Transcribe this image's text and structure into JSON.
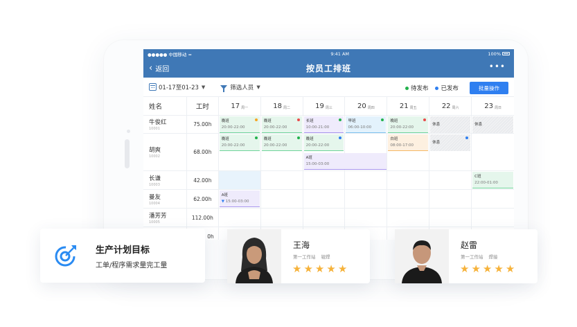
{
  "status_bar": {
    "carrier": "●●●●● 中国移动 ≈",
    "time": "9:41 AM",
    "battery": "100%"
  },
  "nav": {
    "back": "返回",
    "title": "按员工排班",
    "more": "•••"
  },
  "toolbar": {
    "date_range": "01-17至01-23",
    "filter": "筛选人员",
    "legend_pending": "待发布",
    "legend_published": "已发布",
    "batch": "批量操作",
    "colors": {
      "pending": "#22b14c",
      "published": "#2f7ff0",
      "brand": "#3f78b6"
    }
  },
  "grid": {
    "col_name": "姓名",
    "col_hours": "工时",
    "days": [
      {
        "num": "17",
        "wd": "周一"
      },
      {
        "num": "18",
        "wd": "周二"
      },
      {
        "num": "19",
        "wd": "周三"
      },
      {
        "num": "20",
        "wd": "周四"
      },
      {
        "num": "21",
        "wd": "周五"
      },
      {
        "num": "22",
        "wd": "周六"
      },
      {
        "num": "23",
        "wd": "周日"
      }
    ],
    "employees": [
      {
        "name": "牛俊红",
        "id": "10001",
        "hours": "75.00h"
      },
      {
        "name": "胡爽",
        "id": "10002",
        "hours": "68.00h"
      },
      {
        "name": "长谦",
        "id": "10003",
        "hours": "42.00h"
      },
      {
        "name": "曼友",
        "id": "10004",
        "hours": "62.00h"
      },
      {
        "name": "潘芳芳",
        "id": "10005",
        "hours": "112.00h"
      },
      {
        "hours": "0h"
      }
    ],
    "shifts": {
      "e1d1": {
        "name": "晚班",
        "time": "20:00-22:00"
      },
      "e1d2": {
        "name": "晚班",
        "time": "20:00-22:00"
      },
      "e1d3": {
        "name": "长班",
        "time": "10:00-21:00"
      },
      "e1d4": {
        "name": "早班",
        "time": "06:00-10:00"
      },
      "e1d5": {
        "name": "晚班",
        "time": "20:00-22:00"
      },
      "e1d6": {
        "name": "休息"
      },
      "e1d7": {
        "name": "休息"
      },
      "e2d1": {
        "name": "晚班",
        "time": "20:00-22:00"
      },
      "e2d2": {
        "name": "晚班",
        "time": "20:00-22:00"
      },
      "e2d3": {
        "name": "晚班",
        "time": "20:00-22:00"
      },
      "e2d3b": {
        "name": "A班",
        "time": "15:00-03:00"
      },
      "e2d5": {
        "name": "白班",
        "time": "08:00-17:00"
      },
      "e2d6": {
        "name": "休息"
      },
      "e3d7": {
        "name": "C班",
        "time": "22:00-01:00"
      },
      "e4d1": {
        "name": "A班",
        "time": "15:00-03:00"
      }
    }
  },
  "goal_card": {
    "title": "生产计划目标",
    "subtitle": "工单/程序需求量完工量"
  },
  "person_cards": [
    {
      "name": "王海",
      "station": "第一工作站",
      "role": "钳焊",
      "stars": [
        "★",
        "★",
        "★",
        "★",
        "★"
      ]
    },
    {
      "name": "赵雷",
      "station": "第一工作站",
      "role": "焊接",
      "stars": [
        "★",
        "★",
        "★",
        "★",
        "★"
      ]
    }
  ]
}
